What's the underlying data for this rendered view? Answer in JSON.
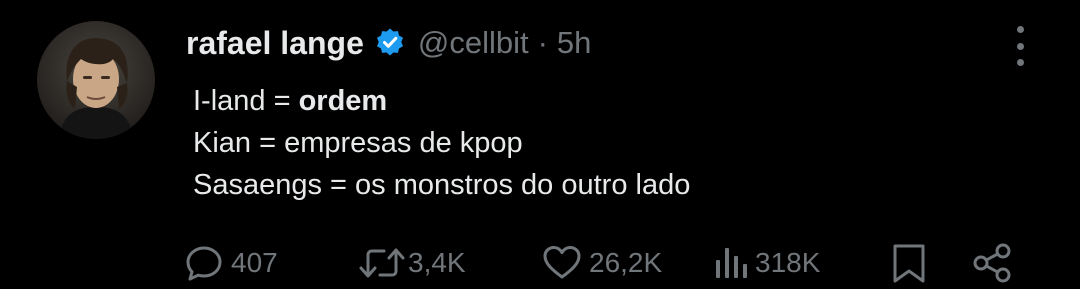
{
  "tweet": {
    "author_name": "rafael lange",
    "handle": "@cellbit",
    "separator": "·",
    "time": "5h",
    "verified": true,
    "text_lines": [
      {
        "before": "I-land = ",
        "bold": "ordem",
        "after": ""
      },
      {
        "before": "Kian = empresas de kpop",
        "bold": "",
        "after": ""
      },
      {
        "before": "Sasaengs = os monstros do outro lado",
        "bold": "",
        "after": ""
      }
    ]
  },
  "actions": {
    "replies": "407",
    "retweets": "3,4K",
    "likes": "26,2K",
    "views": "318K"
  },
  "icons": {
    "verified": "verified-badge-icon",
    "more": "more-vertical-icon",
    "reply": "reply-icon",
    "retweet": "retweet-icon",
    "like": "heart-icon",
    "views": "views-chart-icon",
    "bookmark": "bookmark-icon",
    "share": "share-icon"
  },
  "colors": {
    "background": "#000000",
    "text": "#e7e9ea",
    "secondary": "#71767b",
    "verified": "#1d9bf0"
  }
}
